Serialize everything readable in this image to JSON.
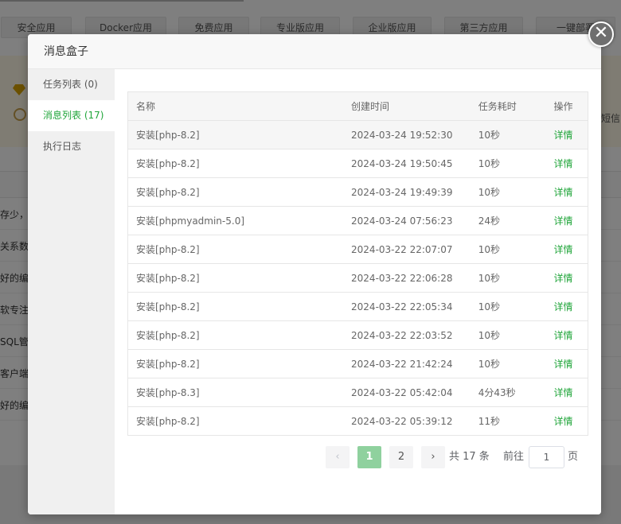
{
  "background": {
    "tabs": [
      "安全应用",
      "Docker应用",
      "免费应用",
      "专业版应用",
      "企业版应用",
      "第三方应用",
      "一键部署"
    ],
    "band_right_text": "短信",
    "rows": [
      "存少，",
      "关系数据",
      "好的编",
      "软专注于",
      "SQL管理",
      "客户端",
      "好的编"
    ]
  },
  "modal": {
    "title": "消息盒子",
    "close_symbol": "✕",
    "sidebar": [
      {
        "label": "任务列表 (0)"
      },
      {
        "label": "消息列表 (17)"
      },
      {
        "label": "执行日志"
      }
    ],
    "table": {
      "headers": [
        "名称",
        "创建时间",
        "任务耗时",
        "操作"
      ],
      "rows": [
        {
          "name": "安装[php-8.2]",
          "time": "2024-03-24 19:52:30",
          "duration": "10秒",
          "op": "详情"
        },
        {
          "name": "安装[php-8.2]",
          "time": "2024-03-24 19:50:45",
          "duration": "10秒",
          "op": "详情"
        },
        {
          "name": "安装[php-8.2]",
          "time": "2024-03-24 19:49:39",
          "duration": "10秒",
          "op": "详情"
        },
        {
          "name": "安装[phpmyadmin-5.0]",
          "time": "2024-03-24 07:56:23",
          "duration": "24秒",
          "op": "详情"
        },
        {
          "name": "安装[php-8.2]",
          "time": "2024-03-22 22:07:07",
          "duration": "10秒",
          "op": "详情"
        },
        {
          "name": "安装[php-8.2]",
          "time": "2024-03-22 22:06:28",
          "duration": "10秒",
          "op": "详情"
        },
        {
          "name": "安装[php-8.2]",
          "time": "2024-03-22 22:05:34",
          "duration": "10秒",
          "op": "详情"
        },
        {
          "name": "安装[php-8.2]",
          "time": "2024-03-22 22:03:52",
          "duration": "10秒",
          "op": "详情"
        },
        {
          "name": "安装[php-8.2]",
          "time": "2024-03-22 21:42:24",
          "duration": "10秒",
          "op": "详情"
        },
        {
          "name": "安装[php-8.3]",
          "time": "2024-03-22 05:42:04",
          "duration": "4分43秒",
          "op": "详情"
        },
        {
          "name": "安装[php-8.2]",
          "time": "2024-03-22 05:39:12",
          "duration": "11秒",
          "op": "详情"
        }
      ]
    },
    "pagination": {
      "prev": "‹",
      "pages": [
        "1",
        "2"
      ],
      "next": "›",
      "total": "共 17 条",
      "goto_label": "前往",
      "goto_value": "1",
      "page_suffix": "页"
    }
  },
  "colors": {
    "accent": "#20a53a",
    "active_page": "#8fd19e"
  }
}
